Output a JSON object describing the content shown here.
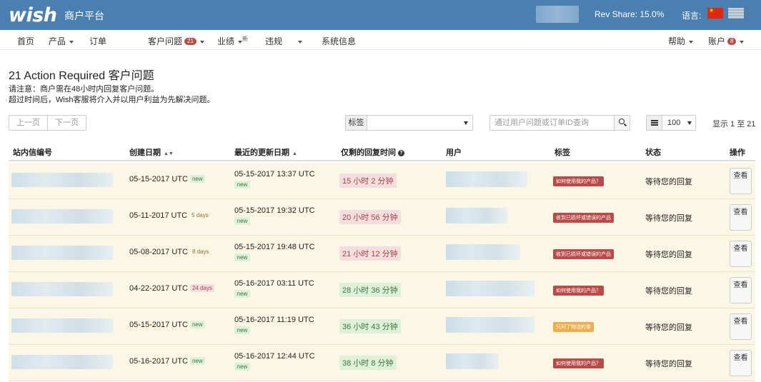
{
  "header": {
    "logo": "wish",
    "brand": "商户平台",
    "rev_share": "Rev Share: 15.0%",
    "language_label": "语言:"
  },
  "nav": {
    "home": "首页",
    "products": "产品",
    "orders": "订单",
    "customer_issues": "客户问题",
    "customer_issues_badge": "21",
    "performance": "业绩",
    "performance_sup": "新",
    "violations": "违规",
    "system_info": "系统信息",
    "help": "帮助",
    "account": "账户",
    "account_badge": "8"
  },
  "page": {
    "title": "21 Action Required 客户问题",
    "notice1": "请注意：商户需在48小时内回复客户问题。",
    "notice2": "超过时间后，Wish客服将介入并以用户利益为先解决问题。"
  },
  "controls": {
    "prev_page": "上一页",
    "next_page": "下一页",
    "tag_label": "标签",
    "tag_value": "",
    "search_placeholder": "通过用户问题或订单ID查询",
    "page_size": "100",
    "showing": "显示 1 至 21"
  },
  "table": {
    "headers": {
      "id": "站内信编号",
      "created": "创建日期",
      "updated": "最近的更新日期",
      "remaining": "仅剩的回复时间",
      "user": "用户",
      "tag": "标签",
      "status": "状态",
      "action": "操作"
    },
    "rows": [
      {
        "created": "05-15-2017 UTC",
        "created_badge": "new",
        "created_badge_type": "new",
        "updated": "05-15-2017 13:37 UTC",
        "updated_badge": "new",
        "remaining": "15 小时 2 分钟",
        "remaining_color": "red",
        "tag": "如何使用我的产品？",
        "tag_color": "red",
        "status": "等待您的回复",
        "action": "查看",
        "user_blur_width": 114
      },
      {
        "created": "05-11-2017 UTC",
        "created_badge": "5 days",
        "created_badge_type": "days",
        "updated": "05-15-2017 19:32 UTC",
        "updated_badge": "new",
        "remaining": "20 小时 56 分钟",
        "remaining_color": "red",
        "tag": "收到已损坏或错误的产品",
        "tag_color": "red",
        "status": "等待您的回复",
        "action": "查看",
        "user_blur_width": 86
      },
      {
        "created": "05-08-2017 UTC",
        "created_badge": "8 days",
        "created_badge_type": "days",
        "updated": "05-15-2017 19:48 UTC",
        "updated_badge": "new",
        "remaining": "21 小时 12 分钟",
        "remaining_color": "red",
        "tag": "收到已损坏或错误的产品",
        "tag_color": "red",
        "status": "等待您的回复",
        "action": "查看",
        "user_blur_width": 104
      },
      {
        "created": "04-22-2017 UTC",
        "created_badge": "24 days",
        "created_badge_type": "days-red",
        "updated": "05-16-2017 03:11 UTC",
        "updated_badge": "new",
        "remaining": "28 小时 36 分钟",
        "remaining_color": "green",
        "tag": "如何使用我的产品？",
        "tag_color": "red",
        "status": "等待您的回复",
        "action": "查看",
        "user_blur_width": 124
      },
      {
        "created": "05-15-2017 UTC",
        "created_badge": "new",
        "created_badge_type": "new",
        "updated": "05-16-2017 11:19 UTC",
        "updated_badge": "new",
        "remaining": "36 小时 43 分钟",
        "remaining_color": "green",
        "tag": "只问了物流的事",
        "tag_color": "orange",
        "status": "等待您的回复",
        "action": "查看",
        "user_blur_width": 124
      },
      {
        "created": "05-16-2017 UTC",
        "created_badge": "new",
        "created_badge_type": "new",
        "updated": "05-16-2017 12:44 UTC",
        "updated_badge": "new",
        "remaining": "38 小时 8 分钟",
        "remaining_color": "green",
        "tag": "如何使用我的产品？",
        "tag_color": "red",
        "status": "等待您的回复",
        "action": "查看",
        "user_blur_width": 74
      }
    ]
  }
}
